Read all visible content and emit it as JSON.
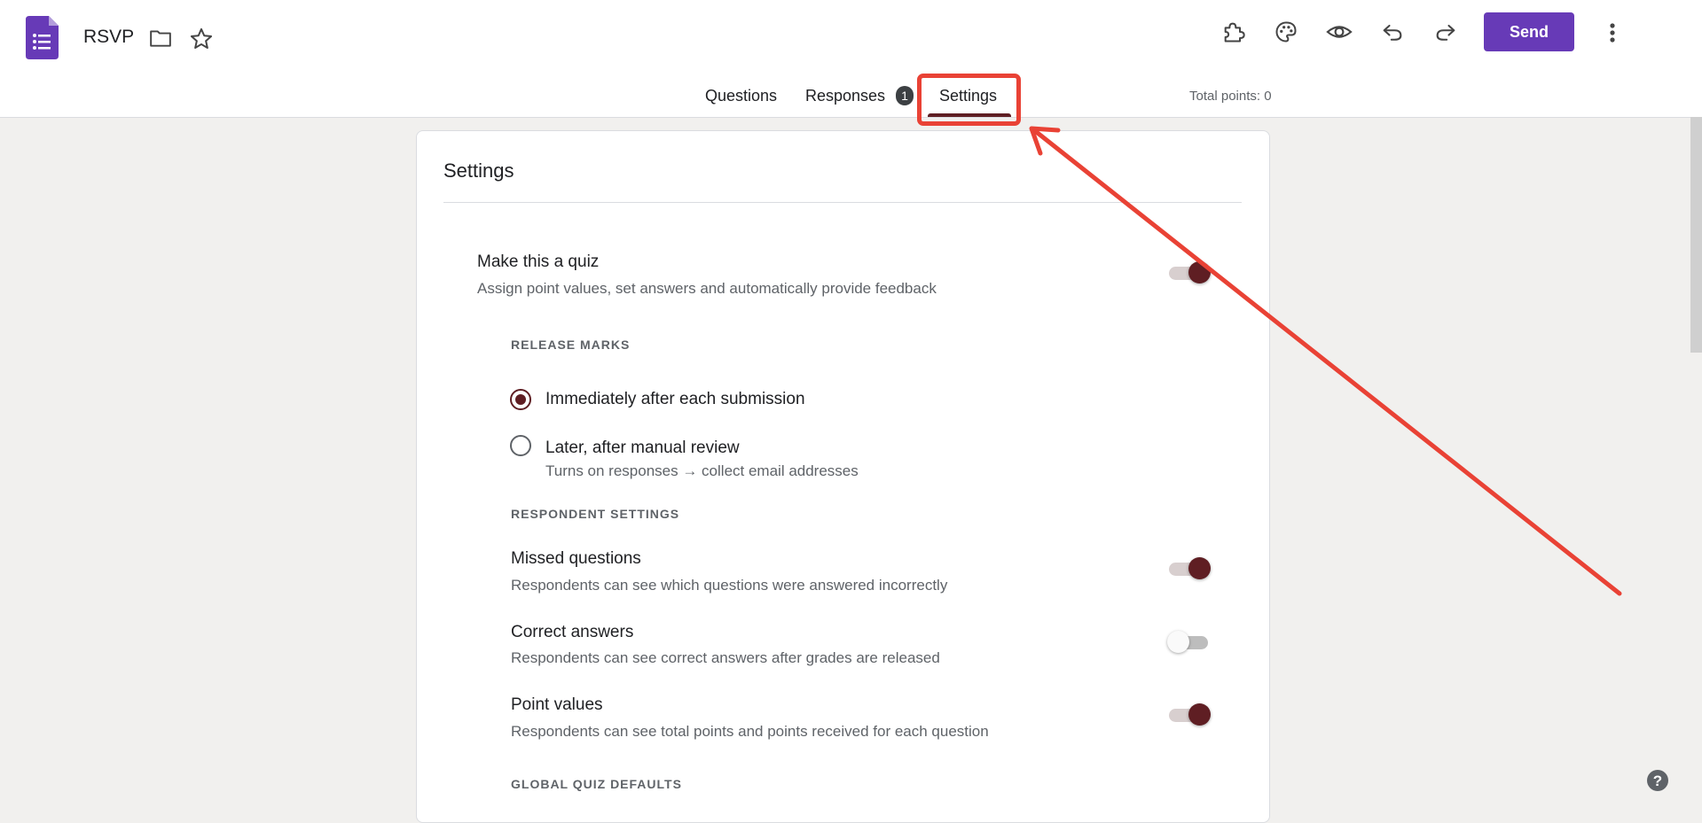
{
  "header": {
    "doc_title": "RSVP",
    "send_label": "Send"
  },
  "tabs": [
    {
      "label": "Questions"
    },
    {
      "label": "Responses",
      "badge": "1"
    },
    {
      "label": "Settings",
      "active": true
    }
  ],
  "total_points": "Total points: 0",
  "settings": {
    "card_title": "Settings",
    "quiz": {
      "title": "Make this a quiz",
      "desc": "Assign point values, set answers and automatically provide feedback",
      "enabled": true
    },
    "release_marks": {
      "label": "RELEASE MARKS",
      "options": [
        {
          "label": "Immediately after each submission",
          "selected": true
        },
        {
          "label": "Later, after manual review",
          "selected": false,
          "note": "Turns on responses → collect email addresses"
        }
      ]
    },
    "respondent": {
      "label": "RESPONDENT SETTINGS",
      "items": [
        {
          "title": "Missed questions",
          "desc": "Respondents can see which questions were answered incorrectly",
          "enabled": true
        },
        {
          "title": "Correct answers",
          "desc": "Respondents can see correct answers after grades are released",
          "enabled": false
        },
        {
          "title": "Point values",
          "desc": "Respondents can see total points and points received for each question",
          "enabled": true
        }
      ]
    },
    "global_defaults_label": "GLOBAL QUIZ DEFAULTS"
  },
  "icons": {
    "app": "google-forms-icon",
    "folder": "folder-icon",
    "star": "star-icon",
    "addons": "puzzle-piece-icon",
    "theme": "palette-icon",
    "preview": "eye-icon",
    "undo": "undo-icon",
    "redo": "redo-icon",
    "more": "more-vert-icon",
    "help": "help-circle-icon"
  },
  "colors": {
    "brand": "#673ab7",
    "accent": "#5f1e23",
    "annotation": "#e94235"
  }
}
